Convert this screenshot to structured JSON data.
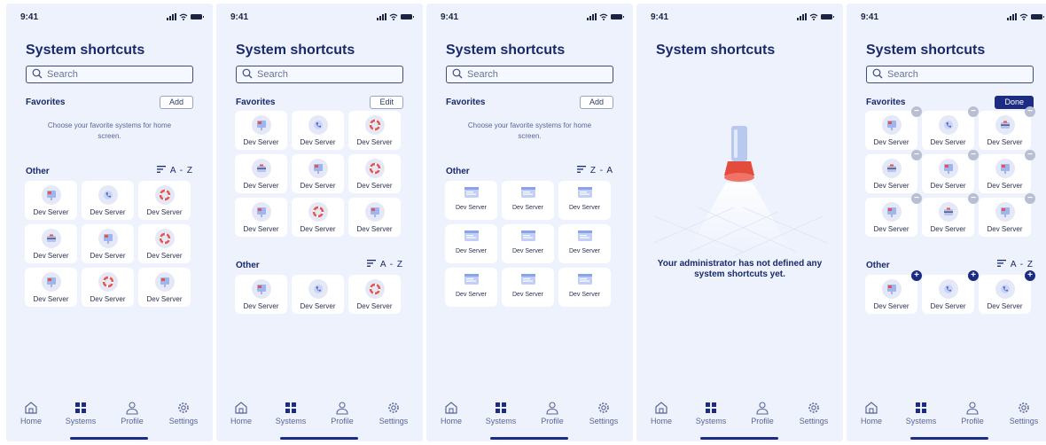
{
  "status": {
    "time": "9:41"
  },
  "title": "System shortcuts",
  "search_placeholder": "Search",
  "favorites_label": "Favorites",
  "other_label": "Other",
  "empty_favorites": "Choose your favorite systems for home screen.",
  "item_label": "Dev Server",
  "empty_state_message": "Your administrator has not defined any system shortcuts yet.",
  "buttons": {
    "add": "Add",
    "edit": "Edit",
    "done": "Done"
  },
  "sort": {
    "az": "A - Z",
    "za": "Z - A"
  },
  "tabs": [
    {
      "label": "Home",
      "icon": "home-icon"
    },
    {
      "label": "Systems",
      "icon": "grid-icon"
    },
    {
      "label": "Profile",
      "icon": "person-icon"
    },
    {
      "label": "Settings",
      "icon": "gear-icon"
    }
  ],
  "screens": [
    {
      "favorites_action": "add",
      "favorites": [],
      "sort": "az",
      "other": [
        "presentation",
        "phone",
        "lifebuoy",
        "database",
        "presentation",
        "lifebuoy",
        "presentation",
        "lifebuoy",
        "presentation"
      ]
    },
    {
      "favorites_action": "edit",
      "sort": "az",
      "favorites": [
        "presentation",
        "phone",
        "lifebuoy",
        "database",
        "presentation",
        "lifebuoy",
        "presentation",
        "lifebuoy",
        "presentation"
      ],
      "other": [
        "presentation",
        "phone",
        "lifebuoy"
      ]
    },
    {
      "favorites_action": "add",
      "favorites": [],
      "sort": "za",
      "other": [
        "browser",
        "browser",
        "browser",
        "browser",
        "browser",
        "browser",
        "browser",
        "browser",
        "browser"
      ]
    },
    {
      "empty": true
    },
    {
      "favorites_action": "done",
      "sort": "az",
      "favorites": [
        "presentation",
        "phone",
        "database",
        "database",
        "presentation",
        "presentation",
        "presentation",
        "database",
        "presentation"
      ],
      "other": [
        "presentation",
        "phone",
        "phone"
      ]
    }
  ],
  "colors": {
    "background": "#eef2fd",
    "accent": "#1c2c83",
    "title": "#182a6b"
  }
}
